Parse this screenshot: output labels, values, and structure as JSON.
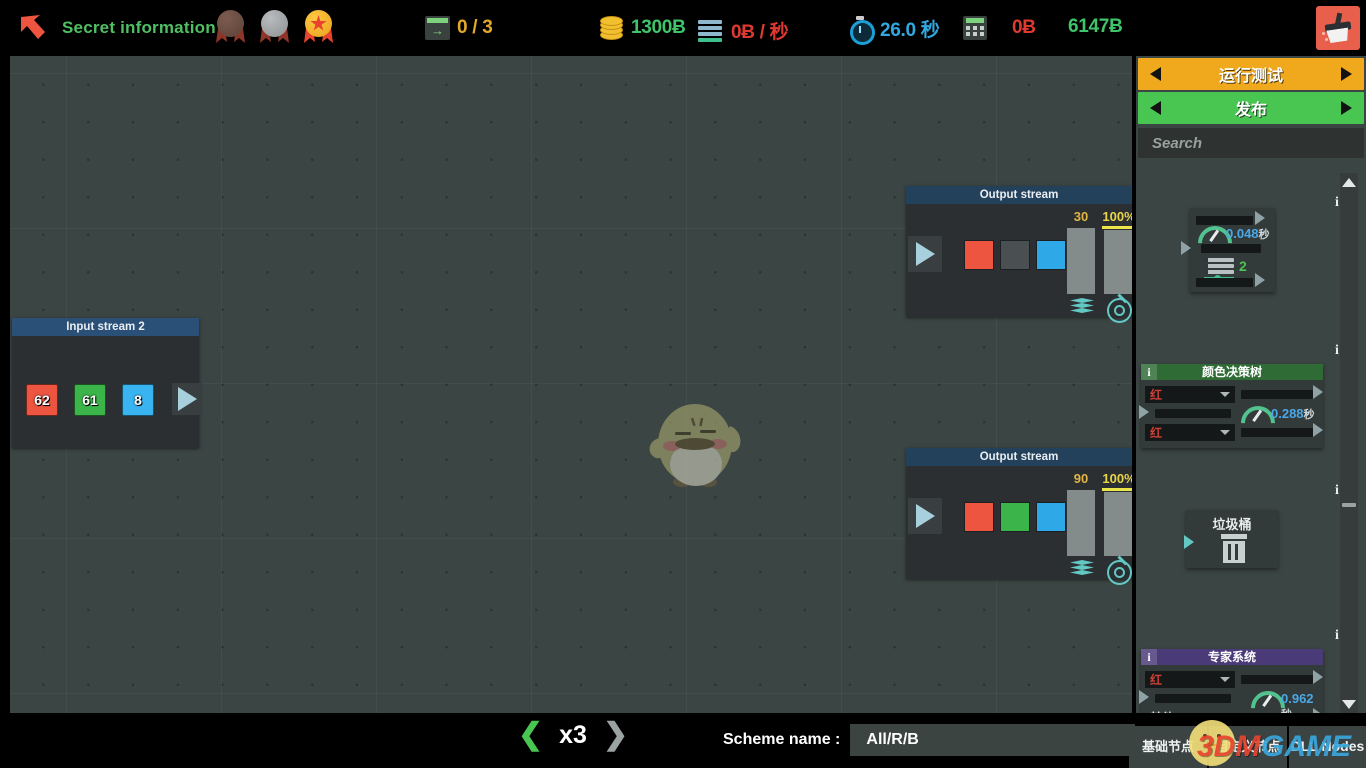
{
  "topbar": {
    "back_icon": "arrow-up-left-icon",
    "title": "Secret information",
    "medals": [
      {
        "name": "medal-bronze",
        "type": "bronze"
      },
      {
        "name": "medal-silver",
        "type": "silver"
      },
      {
        "name": "medal-gold",
        "type": "gold"
      }
    ],
    "stats": [
      {
        "icon": "level-exit-icon",
        "value": "0 / 3",
        "color": "#e3a82a"
      },
      {
        "icon": "coins-icon",
        "value": "1300Ƀ",
        "color": "#3fc46a"
      },
      {
        "icon": "rate-list-icon",
        "value": "0Ƀ / 秒",
        "color": "#e03a30"
      },
      {
        "icon": "stopwatch-icon",
        "value": "26.0 秒",
        "color": "#31a8e0"
      },
      {
        "icon": "calculator-icon",
        "value": "0Ƀ",
        "color": "#e03a30"
      },
      {
        "icon": "",
        "value": "6147Ƀ",
        "color": "#3fc46a"
      }
    ],
    "clean_button": "clear-board-button"
  },
  "canvas": {
    "mascot": "chick-mascot",
    "input_stream": {
      "title": "Input stream 2",
      "blocks": [
        {
          "value": "62",
          "color": "#ee5540"
        },
        {
          "value": "61",
          "color": "#3bb54a"
        },
        {
          "value": "8",
          "color": "#3ab4f0"
        }
      ],
      "play": "play-button"
    },
    "output_streams": [
      {
        "title": "Output stream",
        "play": "play-button",
        "squares": [
          {
            "color": "#ee5540",
            "name": "red"
          },
          {
            "color": "#4a4f52",
            "name": "empty"
          },
          {
            "color": "#2fa8e8",
            "name": "blue"
          }
        ],
        "count": "30",
        "percent": "100%"
      },
      {
        "title": "Output stream",
        "play": "play-button",
        "squares": [
          {
            "color": "#ee5540",
            "name": "red"
          },
          {
            "color": "#3bb54a",
            "name": "green"
          },
          {
            "color": "#2fa8e8",
            "name": "blue"
          }
        ],
        "count": "90",
        "percent": "100%"
      }
    ]
  },
  "panel": {
    "run_test": "运行测试",
    "publish": "发布",
    "search_placeholder": "Search",
    "search_value": "",
    "nodes": [
      {
        "name": "timer-node",
        "title": "",
        "header_color": "",
        "info": "i",
        "time": "0.048",
        "time_unit": "秒",
        "count": "2"
      },
      {
        "name": "color-decision-tree-node",
        "title": "颜色决策树",
        "header_color": "#2e6b35",
        "info": "i",
        "time": "0.288",
        "time_unit": "秒",
        "dropdown_top": "红",
        "dropdown_bottom": "红"
      },
      {
        "name": "trash-can-node",
        "title": "垃圾桶",
        "header_color": "",
        "info": "i",
        "icon": "trash-icon"
      },
      {
        "name": "expert-system-node",
        "title": "专家系统",
        "header_color": "#4a3a78",
        "info": "i",
        "time": "0.962",
        "time_unit": "秒",
        "dropdown_top": "红",
        "dropdown_bottom": "其他"
      }
    ]
  },
  "bottom": {
    "speed_prev": "❮",
    "speed_value": "x3",
    "speed_next": "❯",
    "scheme_label": "Scheme name :",
    "scheme_value": "All/R/B",
    "tabs": [
      {
        "label": "基础节点",
        "name": "tab-basic-nodes"
      },
      {
        "label": "自定义节点",
        "name": "tab-custom-nodes"
      },
      {
        "label": "DLL Nodes",
        "name": "tab-dll-nodes"
      }
    ]
  },
  "watermark": {
    "part1": "3DM",
    "part2": "GAME"
  }
}
